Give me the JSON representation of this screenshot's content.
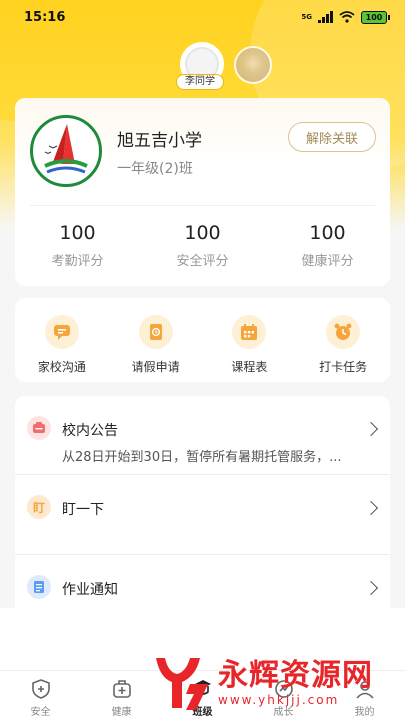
{
  "status_bar": {
    "time": "15:16",
    "network": "5G",
    "battery": "100"
  },
  "profiles": [
    {
      "name": "李同学",
      "active": true
    },
    {
      "name": "",
      "active": false
    }
  ],
  "school": {
    "name": "旭五吉小学",
    "class": "一年级(2)班",
    "unlink_label": "解除关联",
    "stats": [
      {
        "value": "100",
        "label": "考勤评分"
      },
      {
        "value": "100",
        "label": "安全评分"
      },
      {
        "value": "100",
        "label": "健康评分"
      }
    ]
  },
  "quick_actions": [
    {
      "label": "家校沟通",
      "icon": "chat-icon"
    },
    {
      "label": "请假申请",
      "icon": "leave-icon"
    },
    {
      "label": "课程表",
      "icon": "calendar-icon"
    },
    {
      "label": "打卡任务",
      "icon": "alarm-clock-icon"
    }
  ],
  "list": [
    {
      "title": "校内公告",
      "subtitle": "从28日开始到30日，暂停所有暑期托管服务，...",
      "icon": "announcement-icon",
      "color": "#f26d6d"
    },
    {
      "title": "盯一下",
      "subtitle": "",
      "icon": "ding-icon",
      "icon_text": "盯",
      "color": "#f5a53a"
    },
    {
      "title": "作业通知",
      "subtitle": "",
      "icon": "homework-icon",
      "color": "#5b9bf5"
    }
  ],
  "tabs": [
    {
      "label": "安全",
      "icon": "shield-icon",
      "active": false
    },
    {
      "label": "健康",
      "icon": "medkit-icon",
      "active": false
    },
    {
      "label": "班级",
      "icon": "class-icon",
      "active": true
    },
    {
      "label": "成长",
      "icon": "growth-icon",
      "active": false
    },
    {
      "label": "我的",
      "icon": "profile-icon",
      "active": false
    }
  ],
  "watermark": {
    "title": "永辉资源网",
    "url": "www.yhkjjj.com"
  },
  "colors": {
    "brand_yellow": "#ffd21f",
    "accent_orange": "#f5a53a",
    "watermark_red": "#e8262a"
  }
}
